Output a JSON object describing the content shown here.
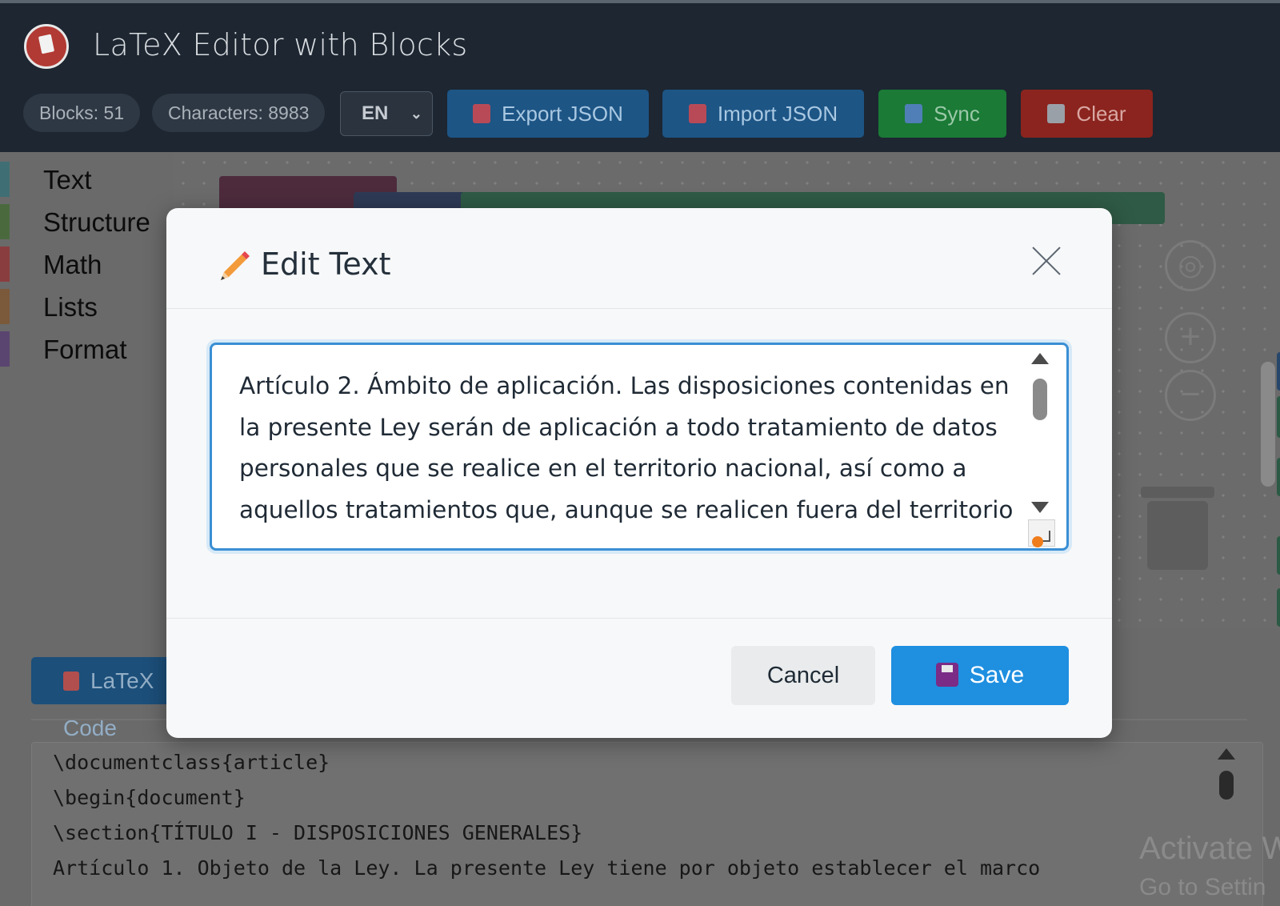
{
  "app": {
    "title": "LaTeX Editor with Blocks",
    "stats": {
      "blocks_label": "Blocks: 51",
      "characters_label": "Characters: 8983"
    },
    "language": "EN",
    "buttons": {
      "export": "Export JSON",
      "import": "Import JSON",
      "sync": "Sync",
      "clear": "Clear"
    }
  },
  "toolbox": {
    "categories": [
      {
        "label": "Text",
        "color": "#3f6f74"
      },
      {
        "label": "Structure",
        "color": "#4a6a3e"
      },
      {
        "label": "Math",
        "color": "#8a3d3f"
      },
      {
        "label": "Lists",
        "color": "#7a5a3a"
      },
      {
        "label": "Format",
        "color": "#5a4570"
      }
    ]
  },
  "workspace": {
    "visible_block_text": "TÍTULO I - DISPOSICIONES GENERALES",
    "block_ellipsis": "..."
  },
  "output": {
    "tab_label": "LaTeX Code",
    "code_lines": [
      "\\documentclass{article}",
      "\\begin{document}",
      "\\section{TÍTULO I - DISPOSICIONES GENERALES}",
      "Artículo 1. Objeto de la Ley. La presente Ley tiene por objeto establecer el marco"
    ]
  },
  "modal": {
    "title": "Edit Text",
    "textarea_value": "Artículo 2. Ámbito de aplicación. Las disposiciones contenidas en la presente Ley serán de aplicación a todo tratamiento de datos personales que se realice en el territorio nacional, así como a aquellos tratamientos que, aunque se realicen fuera del territorio",
    "cancel_label": "Cancel",
    "save_label": "Save"
  },
  "os_overlay": {
    "activate": "Activate W",
    "go_to_settings": "Go to Settin"
  },
  "colors": {
    "accent": "#1f8fe0",
    "export_import": "#1d5585",
    "sync": "#1a7a36",
    "clear": "#8b241e",
    "focus_ring": "#3a8fd4"
  }
}
